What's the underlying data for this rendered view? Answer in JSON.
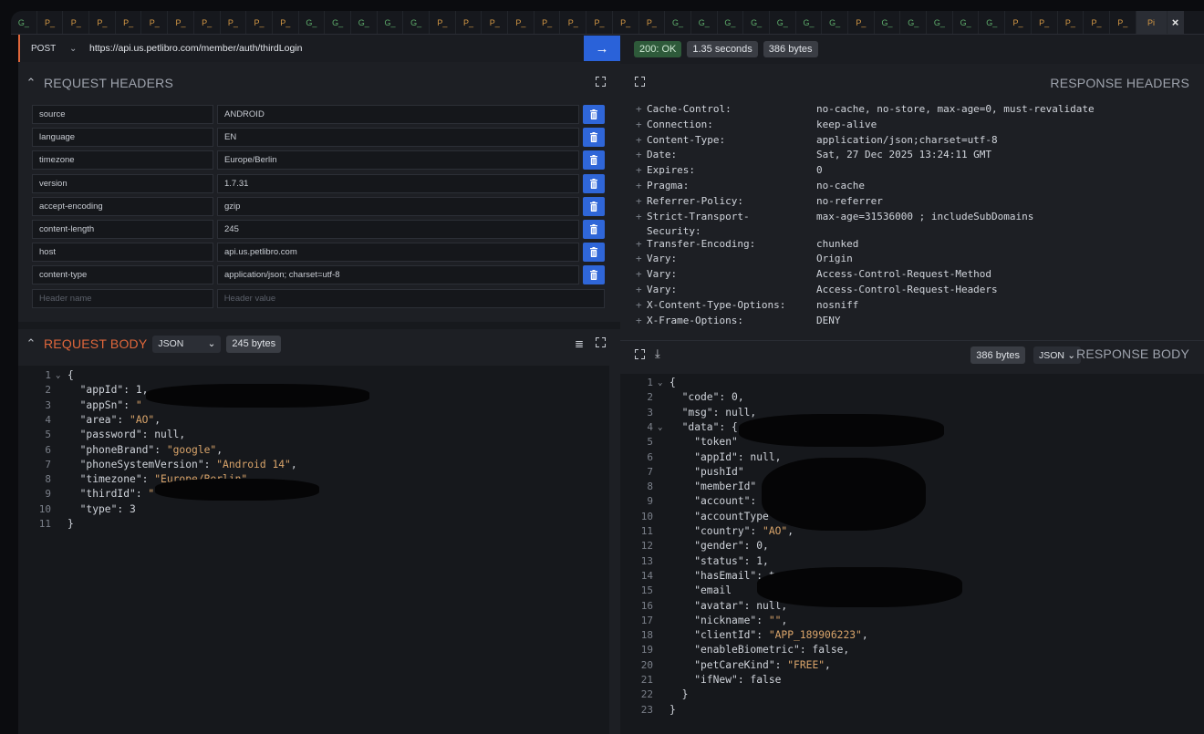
{
  "tabs": [
    {
      "label": "G_",
      "kind": "g"
    },
    {
      "label": "P_",
      "kind": "p"
    },
    {
      "label": "P_",
      "kind": "p"
    },
    {
      "label": "P_",
      "kind": "p"
    },
    {
      "label": "P_",
      "kind": "p"
    },
    {
      "label": "P_",
      "kind": "p"
    },
    {
      "label": "P_",
      "kind": "p"
    },
    {
      "label": "P_",
      "kind": "p"
    },
    {
      "label": "P_",
      "kind": "p"
    },
    {
      "label": "P_",
      "kind": "p"
    },
    {
      "label": "P_",
      "kind": "p"
    },
    {
      "label": "G_",
      "kind": "g"
    },
    {
      "label": "G_",
      "kind": "g"
    },
    {
      "label": "G_",
      "kind": "g"
    },
    {
      "label": "G_",
      "kind": "g"
    },
    {
      "label": "G_",
      "kind": "g"
    },
    {
      "label": "P_",
      "kind": "p"
    },
    {
      "label": "P_",
      "kind": "p"
    },
    {
      "label": "P_",
      "kind": "p"
    },
    {
      "label": "P_",
      "kind": "p"
    },
    {
      "label": "P_",
      "kind": "p"
    },
    {
      "label": "P_",
      "kind": "p"
    },
    {
      "label": "P_",
      "kind": "p"
    },
    {
      "label": "P_",
      "kind": "p"
    },
    {
      "label": "P_",
      "kind": "p"
    },
    {
      "label": "G_",
      "kind": "g"
    },
    {
      "label": "G_",
      "kind": "g"
    },
    {
      "label": "G_",
      "kind": "g"
    },
    {
      "label": "G_",
      "kind": "g"
    },
    {
      "label": "G_",
      "kind": "g"
    },
    {
      "label": "G_",
      "kind": "g"
    },
    {
      "label": "G_",
      "kind": "g"
    },
    {
      "label": "P_",
      "kind": "p"
    },
    {
      "label": "G_",
      "kind": "g"
    },
    {
      "label": "G_",
      "kind": "g"
    },
    {
      "label": "G_",
      "kind": "g"
    },
    {
      "label": "G_",
      "kind": "g"
    },
    {
      "label": "G_",
      "kind": "g"
    },
    {
      "label": "P_",
      "kind": "p"
    },
    {
      "label": "P_",
      "kind": "p"
    },
    {
      "label": "P_",
      "kind": "p"
    },
    {
      "label": "P_",
      "kind": "p"
    },
    {
      "label": "P_",
      "kind": "p"
    },
    {
      "label": "Pi",
      "kind": "active"
    }
  ],
  "tab_close": "×",
  "request": {
    "method": "POST",
    "url": "https://api.us.petlibro.com/member/auth/thirdLogin",
    "send_icon": "→",
    "headers_title": "REQUEST HEADERS",
    "headers": [
      {
        "name": "source",
        "value": "ANDROID"
      },
      {
        "name": "language",
        "value": "EN"
      },
      {
        "name": "timezone",
        "value": "Europe/Berlin"
      },
      {
        "name": "version",
        "value": "1.7.31"
      },
      {
        "name": "accept-encoding",
        "value": "gzip"
      },
      {
        "name": "content-length",
        "value": "245"
      },
      {
        "name": "host",
        "value": "api.us.petlibro.com"
      },
      {
        "name": "content-type",
        "value": "application/json; charset=utf-8"
      }
    ],
    "header_name_placeholder": "Header name",
    "header_value_placeholder": "Header value",
    "body_title": "REQUEST BODY",
    "body_format": "JSON",
    "body_size": "245 bytes",
    "body_lines": [
      {
        "n": "1",
        "fold": true,
        "text": "{"
      },
      {
        "n": "2",
        "text": "  \"appId\": 1,"
      },
      {
        "n": "3",
        "text": "  \"appSn\": \""
      },
      {
        "n": "4",
        "text": "  \"area\": \"AO\","
      },
      {
        "n": "5",
        "text": "  \"password\": null,"
      },
      {
        "n": "6",
        "text": "  \"phoneBrand\": \"google\","
      },
      {
        "n": "7",
        "text": "  \"phoneSystemVersion\": \"Android 14\","
      },
      {
        "n": "8",
        "text": "  \"timezone\": \"Europe/Berlin\","
      },
      {
        "n": "9",
        "text": "  \"thirdId\": \""
      },
      {
        "n": "10",
        "text": "  \"type\": 3"
      },
      {
        "n": "11",
        "text": "}"
      }
    ]
  },
  "response": {
    "status": "200: OK",
    "time": "1.35 seconds",
    "size": "386 bytes",
    "headers_title": "RESPONSE HEADERS",
    "headers": [
      {
        "name": "Cache-Control:",
        "value": "no-cache, no-store, max-age=0, must-revalidate"
      },
      {
        "name": "Connection:",
        "value": "keep-alive"
      },
      {
        "name": "Content-Type:",
        "value": "application/json;charset=utf-8"
      },
      {
        "name": "Date:",
        "value": "Sat, 27 Dec 2025 13:24:11 GMT"
      },
      {
        "name": "Expires:",
        "value": "0"
      },
      {
        "name": "Pragma:",
        "value": "no-cache"
      },
      {
        "name": "Referrer-Policy:",
        "value": "no-referrer"
      },
      {
        "name": "Strict-Transport-\nSecurity:",
        "value": "max-age=31536000 ; includeSubDomains"
      },
      {
        "name": "Transfer-Encoding:",
        "value": "chunked"
      },
      {
        "name": "Vary:",
        "value": "Origin"
      },
      {
        "name": "Vary:",
        "value": "Access-Control-Request-Method"
      },
      {
        "name": "Vary:",
        "value": "Access-Control-Request-Headers"
      },
      {
        "name": "X-Content-Type-Options:",
        "value": "nosniff"
      },
      {
        "name": "X-Frame-Options:",
        "value": "DENY"
      }
    ],
    "body_title": "RESPONSE BODY",
    "body_format": "JSON",
    "body_size": "386 bytes",
    "body_lines": [
      {
        "n": "1",
        "fold": true,
        "text": "{"
      },
      {
        "n": "2",
        "text": "  \"code\": 0,"
      },
      {
        "n": "3",
        "text": "  \"msg\": null,"
      },
      {
        "n": "4",
        "fold": true,
        "text": "  \"data\": {"
      },
      {
        "n": "5",
        "text": "    \"token\""
      },
      {
        "n": "6",
        "text": "    \"appId\": null,"
      },
      {
        "n": "7",
        "text": "    \"pushId\""
      },
      {
        "n": "8",
        "text": "    \"memberId\""
      },
      {
        "n": "9",
        "text": "    \"account\": \""
      },
      {
        "n": "10",
        "text": "    \"accountType\": 3,"
      },
      {
        "n": "11",
        "text": "    \"country\": \"AO\","
      },
      {
        "n": "12",
        "text": "    \"gender\": 0,"
      },
      {
        "n": "13",
        "text": "    \"status\": 1,"
      },
      {
        "n": "14",
        "text": "    \"hasEmail\": t"
      },
      {
        "n": "15",
        "text": "    \"email"
      },
      {
        "n": "16",
        "text": "    \"avatar\": null,"
      },
      {
        "n": "17",
        "text": "    \"nickname\": \"\","
      },
      {
        "n": "18",
        "text": "    \"clientId\": \"APP_189906223\","
      },
      {
        "n": "19",
        "text": "    \"enableBiometric\": false,"
      },
      {
        "n": "20",
        "text": "    \"petCareKind\": \"FREE\","
      },
      {
        "n": "21",
        "text": "    \"ifNew\": false"
      },
      {
        "n": "22",
        "text": "  }"
      },
      {
        "n": "23",
        "text": "}"
      }
    ]
  },
  "colors": {
    "accent_blue": "#2f66d8",
    "accent_orange": "#e0673b",
    "status_ok_bg": "#2e5a3a",
    "string_color": "#d9a46a"
  },
  "icons": {
    "expand": "expand-icon",
    "trash": "trash-icon",
    "download": "download-icon",
    "format": "format-icon",
    "chevron": "chevron-icon",
    "search": "search-icon"
  }
}
